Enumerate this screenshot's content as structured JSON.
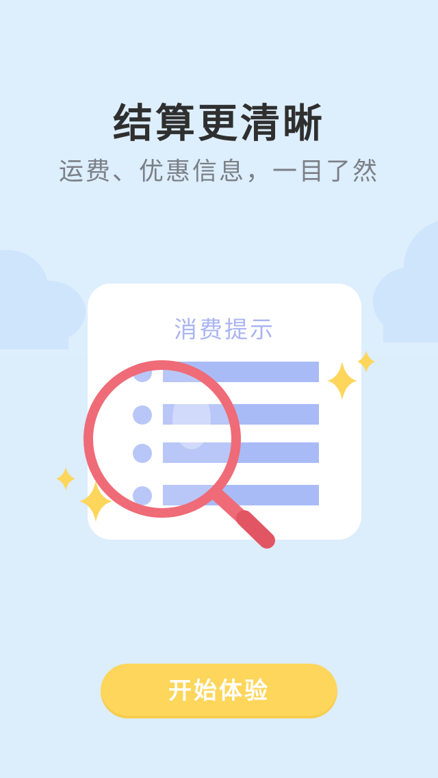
{
  "headline": "结算更清晰",
  "subline": "运费、优惠信息，一目了然",
  "card": {
    "title": "消费提示",
    "row_count": 4
  },
  "cta": {
    "label": "开始体验"
  },
  "colors": {
    "background": "#ddeefd",
    "cloud": "#cfe5fb",
    "card": "#ffffff",
    "list_accent": "#a9bbf6",
    "magnifier": "#ef6b77",
    "sparkle": "#fdd65b",
    "button": "#fdd65b",
    "headline": "#2f2f2f",
    "subline": "#7b7f86"
  },
  "icons": [
    "magnifier-icon",
    "sparkle-icon"
  ]
}
